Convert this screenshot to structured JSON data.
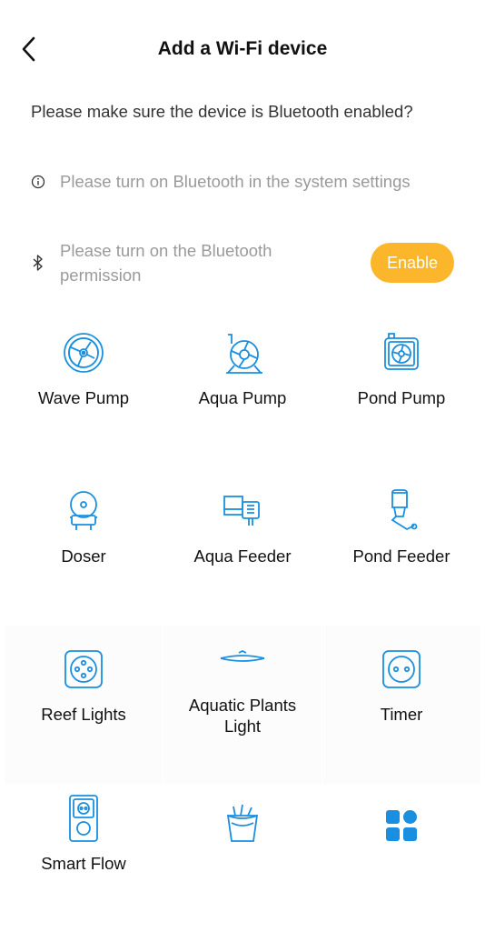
{
  "header": {
    "title": "Add a Wi-Fi device"
  },
  "question": "Please make sure the device is Bluetooth enabled?",
  "info_row": {
    "icon": "info-icon",
    "text": "Please turn on Bluetooth in the system settings"
  },
  "bluetooth_row": {
    "icon": "bluetooth-icon",
    "text": "Please turn on the Bluetooth permission",
    "button": "Enable"
  },
  "colors": {
    "accent": "#1a8fe0",
    "enable": "#fbb62c",
    "muted": "#9a9a9a"
  },
  "devices": [
    {
      "label": "Wave Pump",
      "icon": "wave-pump-icon"
    },
    {
      "label": "Aqua Pump",
      "icon": "aqua-pump-icon"
    },
    {
      "label": "Pond Pump",
      "icon": "pond-pump-icon"
    },
    {
      "label": "Doser",
      "icon": "doser-icon"
    },
    {
      "label": "Aqua Feeder",
      "icon": "aqua-feeder-icon"
    },
    {
      "label": "Pond Feeder",
      "icon": "pond-feeder-icon"
    },
    {
      "label": "Reef Lights",
      "icon": "reef-lights-icon"
    },
    {
      "label": "Aquatic Plants Light",
      "icon": "aquatic-plants-light-icon"
    },
    {
      "label": "Timer",
      "icon": "timer-icon"
    },
    {
      "label": "Smart Flow",
      "icon": "smart-flow-icon"
    },
    {
      "label": "",
      "icon": "bucket-icon"
    },
    {
      "label": "",
      "icon": "more-apps-icon"
    }
  ]
}
